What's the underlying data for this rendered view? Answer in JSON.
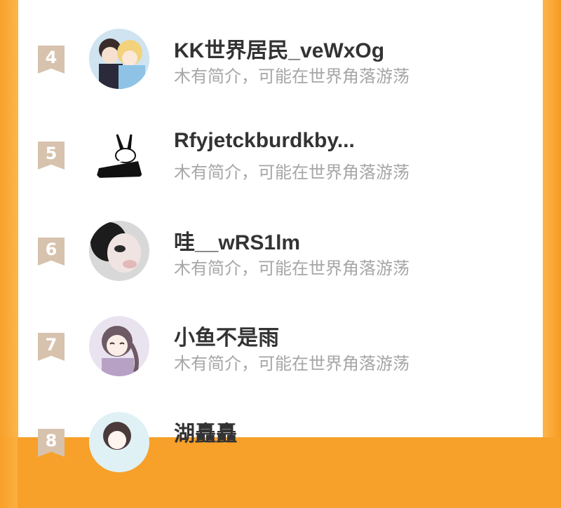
{
  "ranking": [
    {
      "rank": "4",
      "name": "KK世界居民_veWxOg",
      "bio": "木有简介，可能在世界角落游荡",
      "avatar": "anime-couple-avatar"
    },
    {
      "rank": "5",
      "name": "Rfyjetckburdkby...",
      "bio": "木有简介，可能在世界角落游荡",
      "avatar": "bunny-sketch-avatar"
    },
    {
      "rank": "6",
      "name": "哇__wRS1lm",
      "bio": "木有简介，可能在世界角落游荡",
      "avatar": "blurred-selfie-avatar"
    },
    {
      "rank": "7",
      "name": "小鱼不是雨",
      "bio": "木有简介，可能在世界角落游荡",
      "avatar": "anime-girl-avatar"
    },
    {
      "rank": "8",
      "name": "湖矗矗",
      "bio": "",
      "avatar": "sketch-girl-avatar"
    }
  ],
  "colors": {
    "frame": "#f7a02a",
    "card": "#ffffff",
    "rank_badge": "#d7c2ad",
    "name_text": "#333333",
    "bio_text": "#a6a6a6"
  }
}
